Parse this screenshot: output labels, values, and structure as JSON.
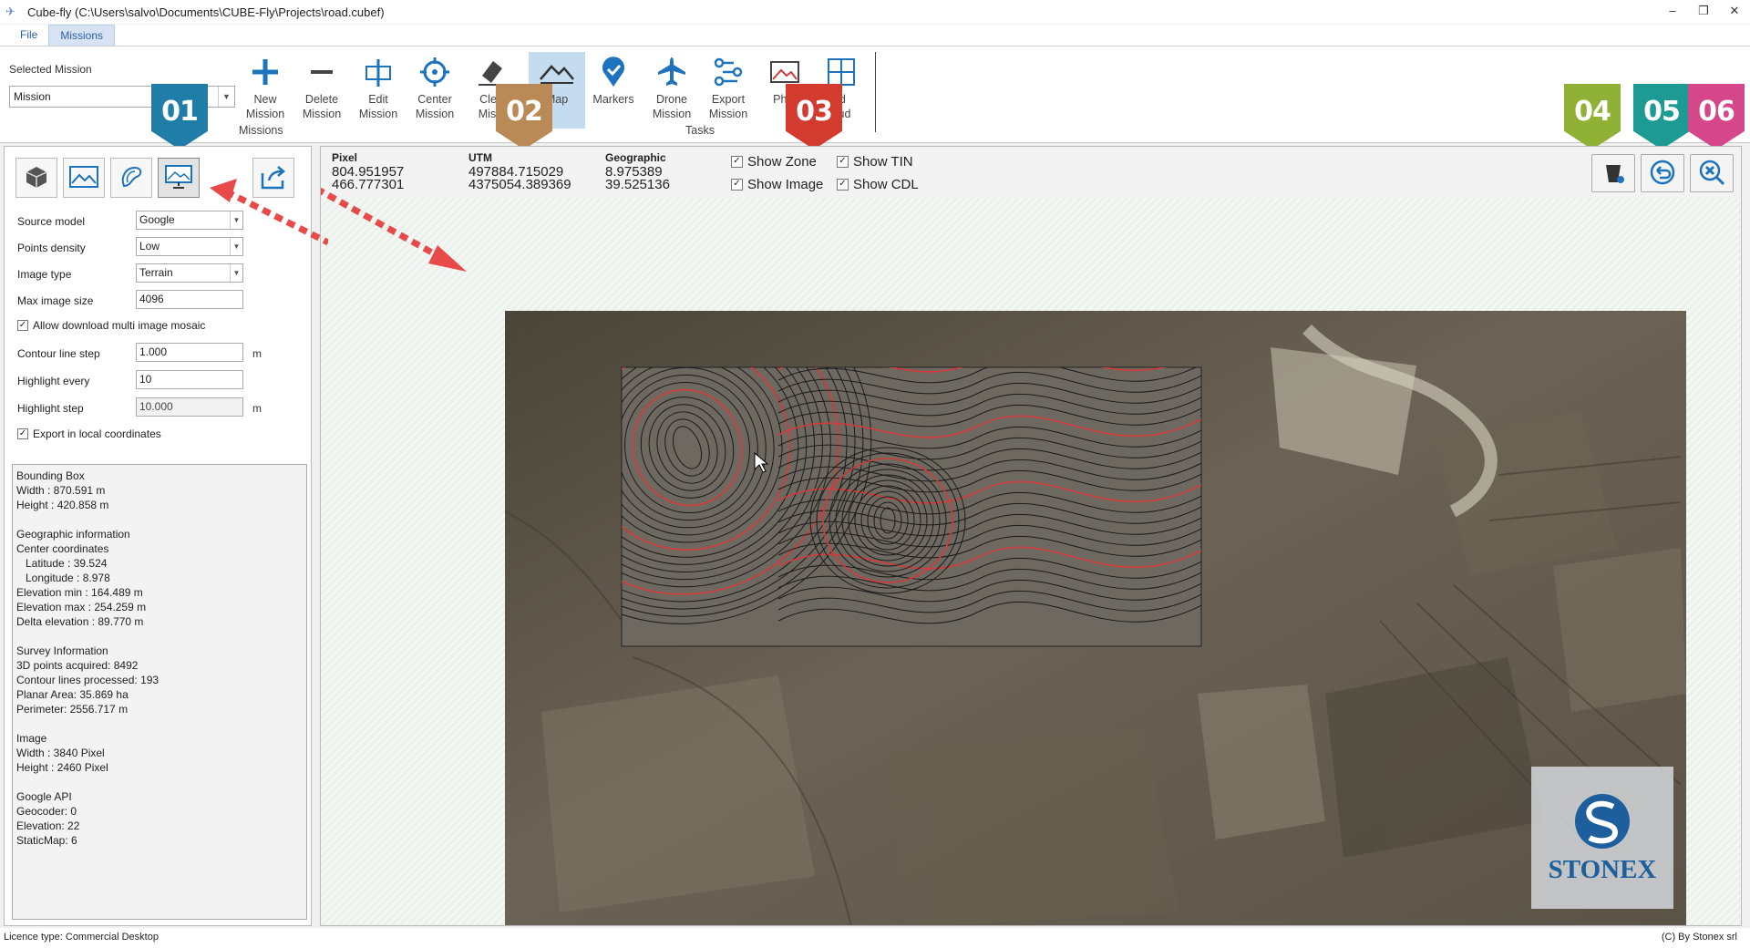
{
  "window": {
    "title": "Cube-fly (C:\\Users\\salvo\\Documents\\CUBE-Fly\\Projects\\road.cubef)"
  },
  "menu": {
    "tabs": [
      "File",
      "Missions"
    ]
  },
  "ribbon": {
    "selected_mission_label": "Selected Mission",
    "selected_mission_value": "Mission",
    "missions_group": "Missions",
    "tasks_group": "Tasks",
    "buttons": {
      "new_mission": [
        "New",
        "Mission"
      ],
      "delete_mission": [
        "Delete",
        "Mission"
      ],
      "edit_mission": [
        "Edit",
        "Mission"
      ],
      "center_mission": [
        "Center",
        "Mission"
      ],
      "clear_mission": [
        "Clea",
        "Missi"
      ],
      "map": [
        "Map",
        ""
      ],
      "markers": [
        "Markers",
        ""
      ],
      "drone_mission": [
        "Drone",
        "Mission"
      ],
      "export_mission": [
        "Export",
        "Mission"
      ],
      "photo": [
        "Phot",
        ""
      ],
      "cloud": [
        "ld",
        "oud"
      ]
    }
  },
  "badges": [
    "01",
    "02",
    "03",
    "04",
    "05",
    "06"
  ],
  "left": {
    "fields": {
      "source_model_label": "Source model",
      "source_model": "Google",
      "points_density_label": "Points density",
      "points_density": "Low",
      "image_type_label": "Image type",
      "image_type": "Terrain",
      "max_image_size_label": "Max image size",
      "max_image_size": "4096",
      "allow_mosaic_label": "Allow download multi image mosaic",
      "contour_step_label": "Contour line step",
      "contour_step": "1.000",
      "contour_step_unit": "m",
      "highlight_every_label": "Highlight every",
      "highlight_every": "10",
      "highlight_step_label": "Highlight step",
      "highlight_step": "10.000",
      "highlight_step_unit": "m",
      "export_local_label": "Export in local coordinates"
    },
    "info": [
      "Bounding Box",
      "Width : 870.591 m",
      "Height : 420.858 m",
      "",
      "Geographic information",
      "Center coordinates",
      "   Latitude : 39.524",
      "   Longitude : 8.978",
      "Elevation min : 164.489 m",
      "Elevation max : 254.259 m",
      "Delta elevation : 89.770 m",
      "",
      "Survey Information",
      "3D points acquired: 8492",
      "Contour lines processed: 193",
      "Planar Area: 35.869 ha",
      "Perimeter: 2556.717 m",
      "",
      "Image",
      "Width : 3840 Pixel",
      "Height : 2460 Pixel",
      "",
      "Google API",
      "Geocoder: 0",
      "Elevation: 22",
      "StaticMap: 6"
    ]
  },
  "coords": {
    "pixel_header": "Pixel",
    "pixel_x": "804.951957",
    "pixel_y": "466.777301",
    "utm_header": "UTM",
    "utm_x": "497884.715029",
    "utm_y": "4375054.389369",
    "geo_header": "Geographic",
    "geo_x": "8.975389",
    "geo_y": "39.525136"
  },
  "toggles": {
    "show_zone": "Show Zone",
    "show_tin": "Show TIN",
    "show_image": "Show Image",
    "show_cdl": "Show CDL"
  },
  "watermark": "STONEX",
  "status": {
    "left": "Licence type: Commercial Desktop",
    "right": "(C) By Stonex srl"
  },
  "colors": {
    "accent": "#1e73be",
    "contour_highlight": "#d23b3b",
    "arrow": "#e84a4a"
  }
}
